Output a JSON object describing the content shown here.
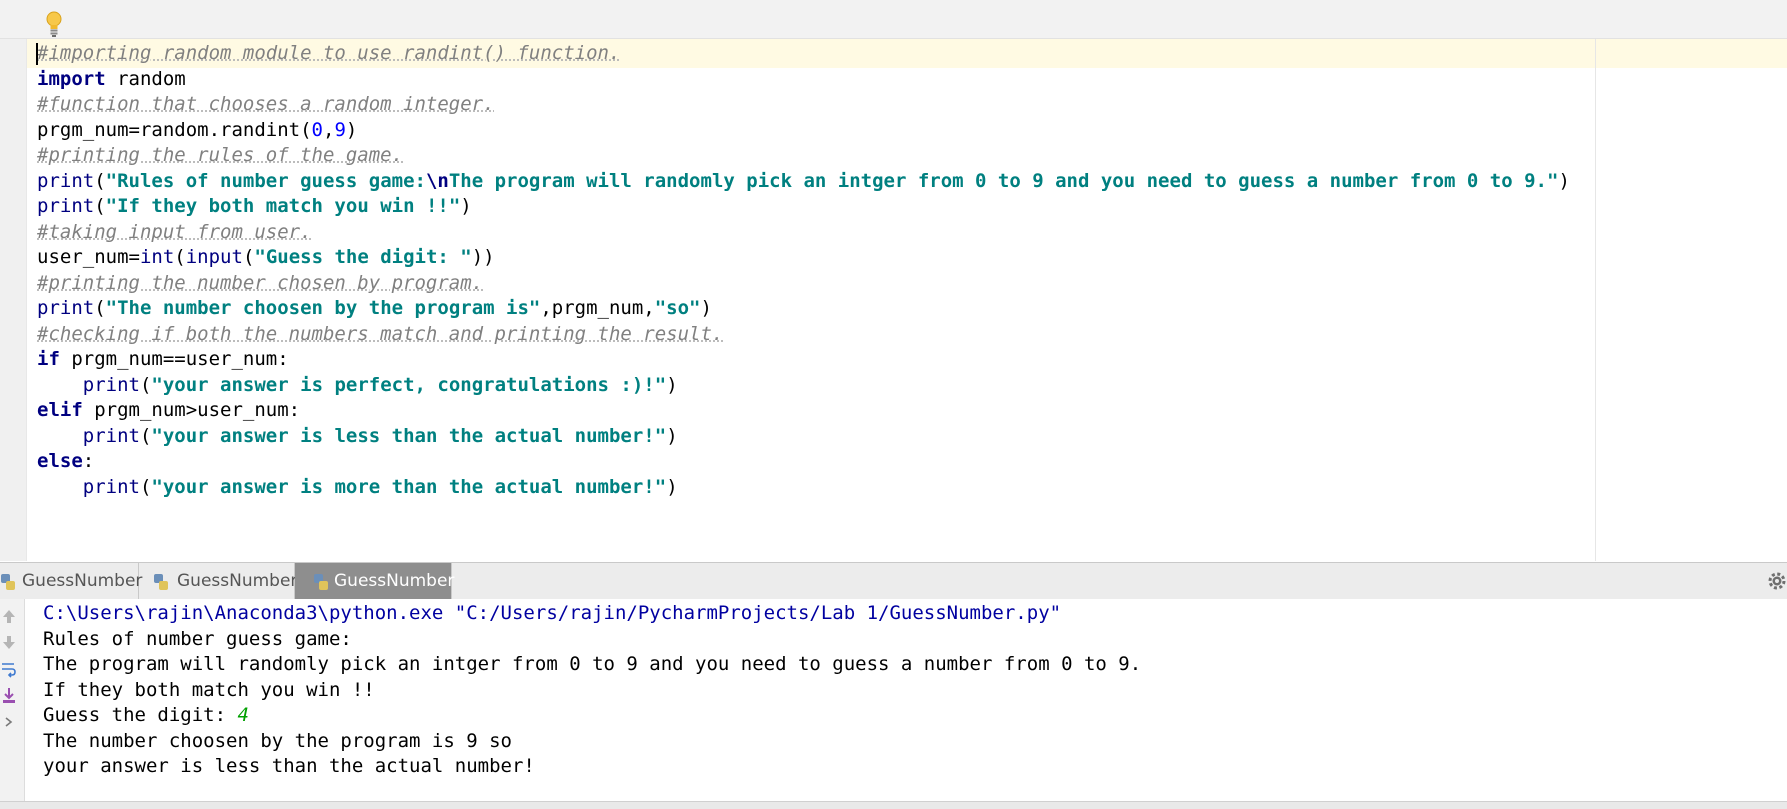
{
  "editor": {
    "lines": [
      [
        {
          "t": "#importing random module to use randint() function.",
          "c": "c"
        }
      ],
      [
        {
          "t": "import",
          "c": "kw"
        },
        {
          "t": " random"
        }
      ],
      [
        {
          "t": "#function that chooses a random integer.",
          "c": "c"
        }
      ],
      [
        {
          "t": "prgm_num=random.randint("
        },
        {
          "t": "0",
          "c": "nm"
        },
        {
          "t": ","
        },
        {
          "t": "9",
          "c": "nm"
        },
        {
          "t": ")"
        }
      ],
      [
        {
          "t": "#printing the rules of the game.",
          "c": "c"
        }
      ],
      [
        {
          "t": "print",
          "c": "bi"
        },
        {
          "t": "("
        },
        {
          "t": "\"Rules of number guess game:",
          "c": "st"
        },
        {
          "t": "\\n",
          "c": "es"
        },
        {
          "t": "The program will randomly pick an intger from 0 to 9 and you need to guess a number from 0 to 9.\"",
          "c": "st"
        },
        {
          "t": ")"
        }
      ],
      [
        {
          "t": "print",
          "c": "bi"
        },
        {
          "t": "("
        },
        {
          "t": "\"If they both match you win !!\"",
          "c": "st"
        },
        {
          "t": ")"
        }
      ],
      [
        {
          "t": "#taking input from user.",
          "c": "c"
        }
      ],
      [
        {
          "t": "user_num="
        },
        {
          "t": "int",
          "c": "bi"
        },
        {
          "t": "("
        },
        {
          "t": "input",
          "c": "bi"
        },
        {
          "t": "("
        },
        {
          "t": "\"Guess the digit: \"",
          "c": "st"
        },
        {
          "t": "))"
        }
      ],
      [
        {
          "t": "#printing the number chosen by program.",
          "c": "c"
        }
      ],
      [
        {
          "t": "print",
          "c": "bi"
        },
        {
          "t": "("
        },
        {
          "t": "\"The number choosen by the program is\"",
          "c": "st"
        },
        {
          "t": ",prgm_num,"
        },
        {
          "t": "\"so\"",
          "c": "st"
        },
        {
          "t": ")"
        }
      ],
      [
        {
          "t": "#checking if both the numbers match and printing the result.",
          "c": "c"
        }
      ],
      [
        {
          "t": "if",
          "c": "kw"
        },
        {
          "t": " prgm_num==user_num:"
        }
      ],
      [
        {
          "t": "    "
        },
        {
          "t": "print",
          "c": "bi"
        },
        {
          "t": "("
        },
        {
          "t": "\"your answer is perfect, congratulations :)!\"",
          "c": "st"
        },
        {
          "t": ")"
        }
      ],
      [
        {
          "t": "elif",
          "c": "kw"
        },
        {
          "t": " prgm_num>user_num:"
        }
      ],
      [
        {
          "t": "    "
        },
        {
          "t": "print",
          "c": "bi"
        },
        {
          "t": "("
        },
        {
          "t": "\"your answer is less than the actual number!\"",
          "c": "st"
        },
        {
          "t": ")"
        }
      ],
      [
        {
          "t": "else",
          "c": "kw"
        },
        {
          "t": ":"
        }
      ],
      [
        {
          "t": "    "
        },
        {
          "t": "print",
          "c": "bi"
        },
        {
          "t": "("
        },
        {
          "t": "\"your answer is more than the actual number!\"",
          "c": "st"
        },
        {
          "t": ")"
        }
      ]
    ]
  },
  "run": {
    "tabs": [
      {
        "label": "GuessNumber",
        "active": false
      },
      {
        "label": "GuessNumber",
        "active": false
      },
      {
        "label": "GuessNumber",
        "active": true
      }
    ],
    "gutter_icons": [
      "up-arrow-icon",
      "down-arrow-icon",
      "soft-wrap-icon",
      "scroll-to-end-icon",
      "expand-icon"
    ],
    "output": [
      [
        {
          "t": "C:\\Users\\rajin\\Anaconda3\\python.exe \"C:/Users/rajin/PycharmProjects/Lab 1/GuessNumber.py\"",
          "c": "cmd"
        }
      ],
      [
        {
          "t": "Rules of number guess game:"
        }
      ],
      [
        {
          "t": "The program will randomly pick an intger from 0 to 9 and you need to guess a number from 0 to 9."
        }
      ],
      [
        {
          "t": "If they both match you win !!"
        }
      ],
      [
        {
          "t": "Guess the digit: "
        },
        {
          "t": "4",
          "c": "usr"
        }
      ],
      [
        {
          "t": "The number choosen by the program is 9 so"
        }
      ],
      [
        {
          "t": "your answer is less than the actual number!"
        }
      ]
    ]
  }
}
